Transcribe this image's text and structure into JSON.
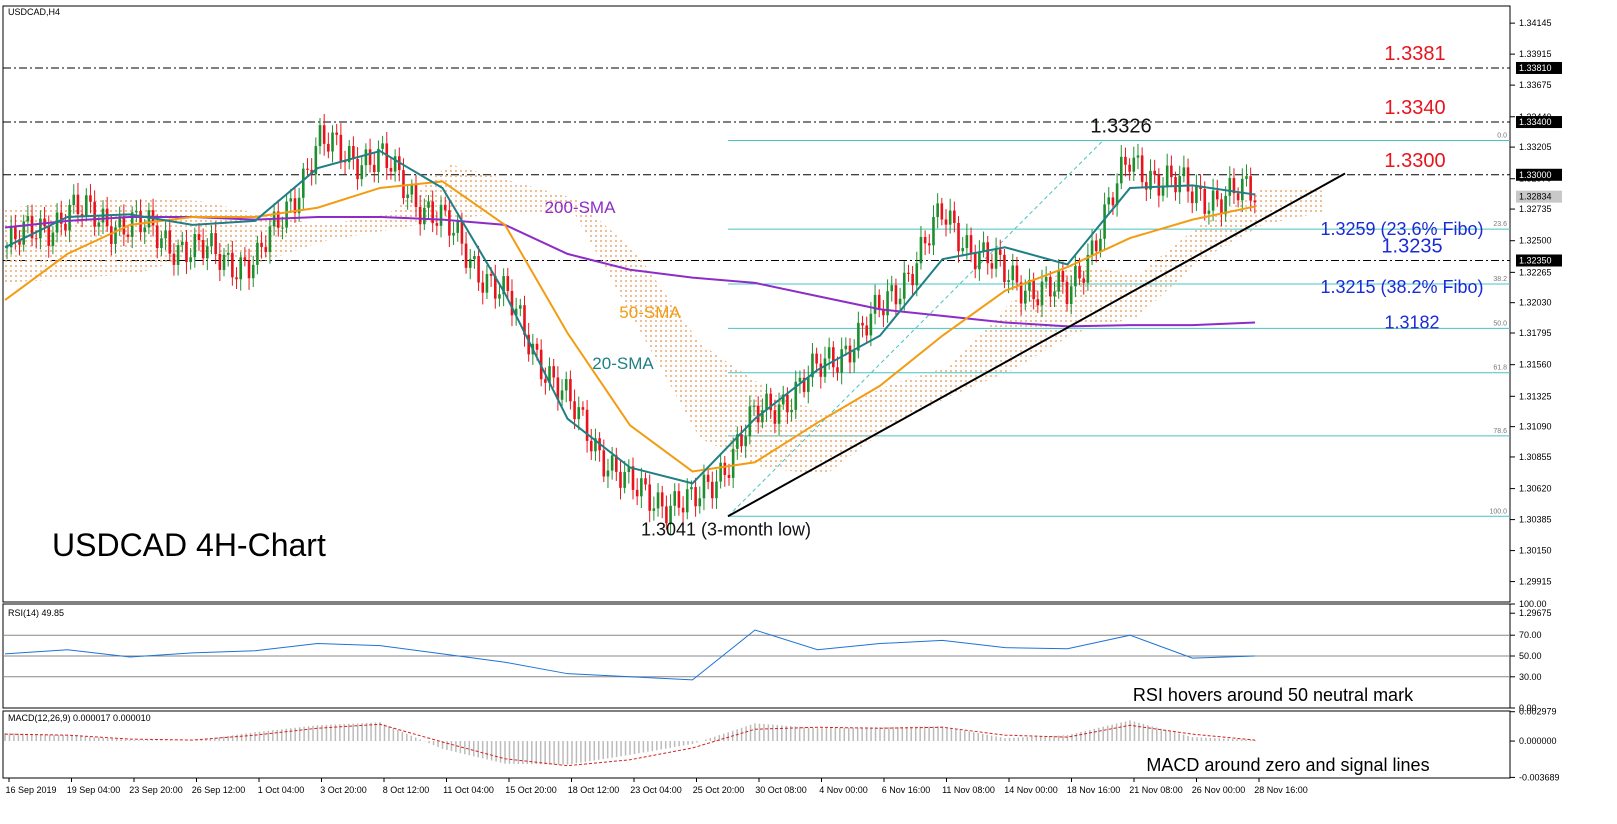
{
  "chart_data": [
    {
      "type": "line",
      "panel": "price",
      "title_tag": "USDCAD,H4",
      "title": "USDCAD 4H-Chart",
      "ylim": [
        1.2976,
        1.3428
      ],
      "y_ticks": [
        {
          "value": 1.3415,
          "label": "1.34145"
        },
        {
          "value": 1.33915,
          "label": "1.33915"
        },
        {
          "value": 1.3368,
          "label": "1.33675"
        },
        {
          "value": 1.3344,
          "label": "1.33440"
        },
        {
          "value": 1.3321,
          "label": "1.33205"
        },
        {
          "value": 1.3297,
          "label": "1.32970"
        },
        {
          "value": 1.3274,
          "label": "1.32735"
        },
        {
          "value": 1.325,
          "label": "1.32500"
        },
        {
          "value": 1.3226,
          "label": "1.32265"
        },
        {
          "value": 1.3203,
          "label": "1.32030"
        },
        {
          "value": 1.318,
          "label": "1.31795"
        },
        {
          "value": 1.3156,
          "label": "1.31560"
        },
        {
          "value": 1.3132,
          "label": "1.31325"
        },
        {
          "value": 1.3109,
          "label": "1.31090"
        },
        {
          "value": 1.3086,
          "label": "1.30855"
        },
        {
          "value": 1.3062,
          "label": "1.30620"
        },
        {
          "value": 1.30385,
          "label": "1.30385"
        },
        {
          "value": 1.3015,
          "label": "1.30150"
        },
        {
          "value": 1.29915,
          "label": "1.29915"
        },
        {
          "value": 1.29675,
          "label": "1.29675"
        }
      ],
      "price_tags": [
        {
          "value": 1.3381,
          "label": "1.33810",
          "style": "black"
        },
        {
          "value": 1.334,
          "label": "1.33400",
          "style": "black"
        },
        {
          "value": 1.33,
          "label": "1.33000",
          "style": "black"
        },
        {
          "value": 1.32834,
          "label": "1.32834",
          "style": "grey"
        },
        {
          "value": 1.3235,
          "label": "1.32350",
          "style": "black"
        }
      ],
      "x_labels": [
        "16 Sep 2019",
        "19 Sep 04:00",
        "23 Sep 20:00",
        "26 Sep 12:00",
        "1 Oct 04:00",
        "3 Oct 20:00",
        "8 Oct 12:00",
        "11 Oct 04:00",
        "15 Oct 20:00",
        "18 Oct 12:00",
        "23 Oct 04:00",
        "25 Oct 20:00",
        "30 Oct 08:00",
        "4 Nov 00:00",
        "6 Nov 16:00",
        "11 Nov 08:00",
        "14 Nov 00:00",
        "18 Nov 16:00",
        "21 Nov 08:00",
        "26 Nov 00:00",
        "28 Nov 16:00"
      ],
      "levels": [
        {
          "value": 1.3381,
          "label": "1.3381",
          "color": "#e8141d"
        },
        {
          "value": 1.334,
          "label": "1.3340",
          "color": "#e8141d"
        },
        {
          "value": 1.33,
          "label": "1.3300",
          "color": "#e8141d"
        },
        {
          "value": 1.3235,
          "label": "1.3235",
          "color": "#1a2bd6"
        }
      ],
      "fibo": {
        "from_value": 1.3041,
        "to_value": 1.3326,
        "levels": [
          {
            "ratio": 0.0,
            "label": "0.0"
          },
          {
            "ratio": 23.6,
            "label": "23.6"
          },
          {
            "ratio": 38.2,
            "label": "38.2"
          },
          {
            "ratio": 50.0,
            "label": "50.0"
          },
          {
            "ratio": 61.8,
            "label": "61.8"
          },
          {
            "ratio": 78.6,
            "label": "78.6"
          },
          {
            "ratio": 100.0,
            "label": "100.0"
          }
        ]
      },
      "annotations": [
        {
          "text": "1.3326",
          "color": "#111111"
        },
        {
          "text": "1.3259 (23.6% Fibo)",
          "color": "#1a2bd6"
        },
        {
          "text": "1.3215 (38.2% Fibo)",
          "color": "#1a2bd6"
        },
        {
          "text": "1.3182",
          "color": "#1a2bd6"
        },
        {
          "text": "1.3041 (3-month low)",
          "color": "#111111"
        },
        {
          "text": "200-SMA",
          "color": "#8d2cc9"
        },
        {
          "text": "50-SMA",
          "color": "#f39c12"
        },
        {
          "text": "20-SMA",
          "color": "#1e7f85"
        }
      ],
      "series": [
        {
          "name": "200-SMA",
          "color": "#8d2cc9",
          "values": [
            1.326,
            1.3265,
            1.3268,
            1.3268,
            1.3266,
            1.3268,
            1.3268,
            1.3266,
            1.3262,
            1.324,
            1.3228,
            1.3222,
            1.3218,
            1.3208,
            1.3198,
            1.3193,
            1.3188,
            1.3185,
            1.3186,
            1.3186,
            1.3188
          ]
        },
        {
          "name": "50-SMA",
          "color": "#f39c12",
          "values": [
            1.3205,
            1.324,
            1.3262,
            1.3268,
            1.3268,
            1.3275,
            1.329,
            1.3295,
            1.3262,
            1.318,
            1.311,
            1.3075,
            1.3082,
            1.3112,
            1.314,
            1.3178,
            1.3212,
            1.323,
            1.3252,
            1.3266,
            1.3276
          ]
        },
        {
          "name": "20-SMA",
          "color": "#1e7f85",
          "values": [
            1.3245,
            1.3268,
            1.327,
            1.3262,
            1.3265,
            1.3305,
            1.3318,
            1.329,
            1.321,
            1.3115,
            1.3078,
            1.3066,
            1.3115,
            1.3152,
            1.3178,
            1.3236,
            1.3245,
            1.3232,
            1.329,
            1.3292,
            1.3285
          ]
        }
      ]
    },
    {
      "type": "line",
      "panel": "rsi",
      "title": "RSI(14) 49.85",
      "ylim": [
        0,
        100
      ],
      "y_ticks": [
        100,
        70,
        50,
        30,
        0
      ],
      "y_tick_labels": [
        "100.00",
        "70.00",
        "50.00",
        "30.00",
        "0.00"
      ],
      "caption": "RSI hovers around 50 neutral mark",
      "series": [
        {
          "name": "RSI(14)",
          "color": "#1e73d8",
          "values": [
            52,
            56,
            49,
            53,
            55,
            62,
            60,
            52,
            44,
            33,
            30,
            27,
            75,
            56,
            62,
            65,
            58,
            57,
            70,
            48,
            50
          ]
        }
      ]
    },
    {
      "type": "bar",
      "panel": "macd",
      "title": "MACD(12,26,9) 0.000017 0.000010",
      "ylim": [
        -0.00375,
        0.00305
      ],
      "y_ticks": [
        0.002979,
        0.0,
        -0.003689
      ],
      "y_tick_labels": [
        "0.002979",
        "0.000000",
        "-0.003689"
      ],
      "caption": "MACD around zero and signal lines",
      "series": [
        {
          "name": "MACD histogram",
          "color": "#bbbbbb",
          "values": [
            0.0008,
            0.0006,
            0.0001,
            0.0,
            0.0009,
            0.0016,
            0.0019,
            -0.0008,
            -0.0023,
            -0.0024,
            -0.0014,
            -0.0003,
            0.0018,
            0.0013,
            0.0014,
            0.0015,
            0.0003,
            0.0006,
            0.0021,
            0.0004,
            0.0001
          ]
        },
        {
          "name": "Signal",
          "color": "#d62020",
          "values": [
            0.0007,
            0.0006,
            0.0002,
            0.0001,
            0.0006,
            0.0013,
            0.0017,
            -0.0001,
            -0.0018,
            -0.0025,
            -0.0019,
            -0.0007,
            0.0012,
            0.0014,
            0.0013,
            0.0014,
            0.0006,
            0.0004,
            0.0016,
            0.0007,
            0.0001
          ]
        }
      ]
    }
  ]
}
